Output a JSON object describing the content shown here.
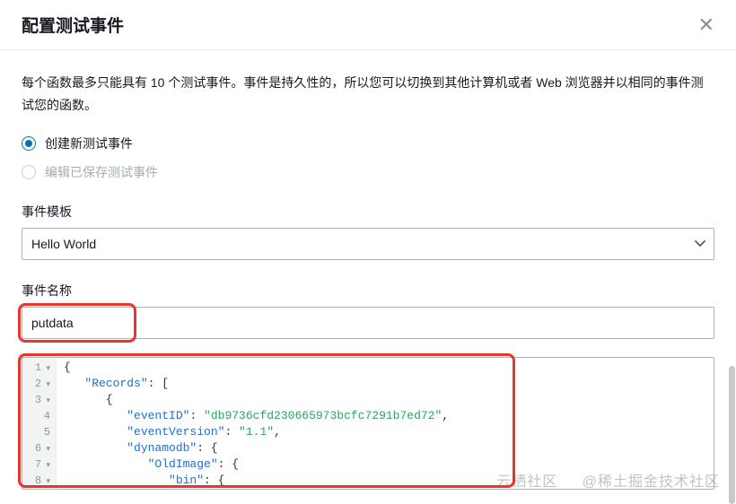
{
  "header": {
    "title": "配置测试事件"
  },
  "intro": "每个函数最多只能具有 10 个测试事件。事件是持久性的，所以您可以切换到其他计算机或者 Web 浏览器并以相同的事件测试您的函数。",
  "radios": {
    "create": "创建新测试事件",
    "edit": "编辑已保存测试事件"
  },
  "templateLabel": "事件模板",
  "templateValue": "Hello World",
  "nameLabel": "事件名称",
  "nameValue": "putdata",
  "code": {
    "lines": [
      {
        "n": "1",
        "fold": true,
        "segments": [
          {
            "t": "{",
            "c": "tok-brace"
          }
        ]
      },
      {
        "n": "2",
        "fold": true,
        "indent": 1,
        "segments": [
          {
            "t": "\"Records\"",
            "c": "tok-key"
          },
          {
            "t": ": [",
            "c": "tok-punc"
          }
        ]
      },
      {
        "n": "3",
        "fold": true,
        "indent": 2,
        "segments": [
          {
            "t": "{",
            "c": "tok-brace"
          }
        ]
      },
      {
        "n": "4",
        "fold": false,
        "indent": 3,
        "segments": [
          {
            "t": "\"eventID\"",
            "c": "tok-key"
          },
          {
            "t": ": ",
            "c": "tok-punc"
          },
          {
            "t": "\"db9736cfd230665973bcfc7291b7ed72\"",
            "c": "tok-str"
          },
          {
            "t": ",",
            "c": "tok-punc"
          }
        ]
      },
      {
        "n": "5",
        "fold": false,
        "indent": 3,
        "segments": [
          {
            "t": "\"eventVersion\"",
            "c": "tok-key"
          },
          {
            "t": ": ",
            "c": "tok-punc"
          },
          {
            "t": "\"1.1\"",
            "c": "tok-str"
          },
          {
            "t": ",",
            "c": "tok-punc"
          }
        ]
      },
      {
        "n": "6",
        "fold": true,
        "indent": 3,
        "segments": [
          {
            "t": "\"dynamodb\"",
            "c": "tok-key"
          },
          {
            "t": ": {",
            "c": "tok-punc"
          }
        ]
      },
      {
        "n": "7",
        "fold": true,
        "indent": 4,
        "segments": [
          {
            "t": "\"OldImage\"",
            "c": "tok-key"
          },
          {
            "t": ": {",
            "c": "tok-punc"
          }
        ]
      },
      {
        "n": "8",
        "fold": true,
        "indent": 5,
        "segments": [
          {
            "t": "\"bin\"",
            "c": "tok-key"
          },
          {
            "t": ": {",
            "c": "tok-punc"
          }
        ]
      }
    ]
  },
  "watermark": {
    "left": "云栖社区",
    "right": "@稀土掘金技术社区"
  }
}
